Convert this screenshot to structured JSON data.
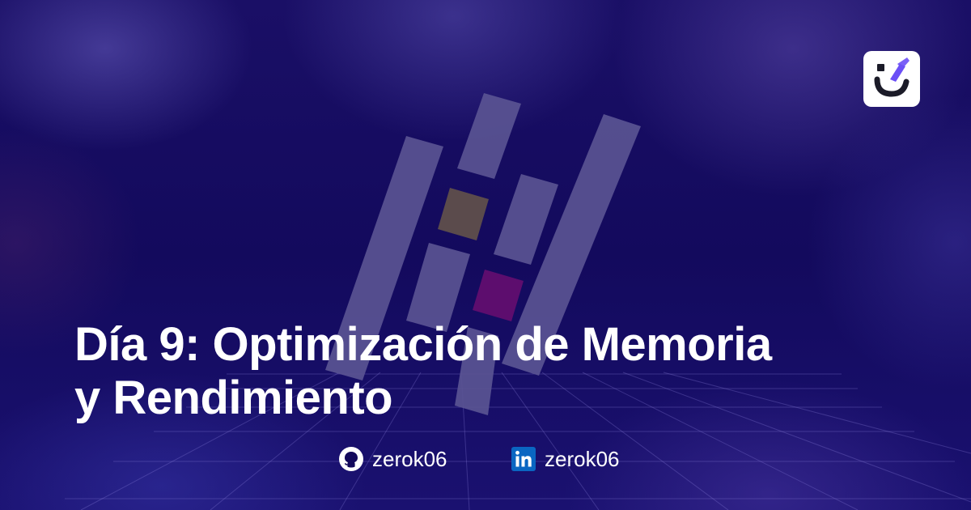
{
  "post": {
    "title_line1": "Día 9: Optimización de Memoria",
    "title_line2": "y Rendimiento"
  },
  "brand": {
    "icon": "checkmark-smile-icon",
    "accent_color": "#6b4ff6"
  },
  "social": {
    "github": {
      "icon": "github-icon",
      "handle": "zerok06"
    },
    "linkedin": {
      "icon": "linkedin-icon",
      "handle": "zerok06",
      "color": "#0a66c2"
    }
  },
  "colors": {
    "background": "#13095c",
    "text": "#ffffff",
    "logo_bars": "#5a5493",
    "logo_square_brown": "#5b4b4c",
    "logo_square_purple": "#5d0d6e"
  }
}
